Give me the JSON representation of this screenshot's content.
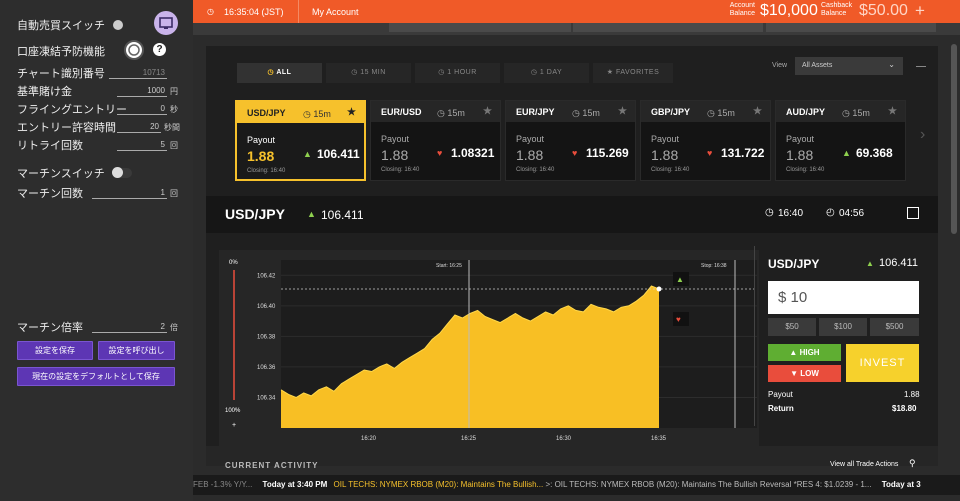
{
  "left": {
    "auto_trade_label": "自動売買スイッチ",
    "freeze_label": "口座凍結予防機能",
    "help_icon": "?",
    "chart_id_label": "チャート識別番号",
    "chart_id_value": "10713",
    "base_bet_label": "基準賭け金",
    "base_bet_value": "1000",
    "base_bet_unit": "円",
    "flying_label": "フライングエントリー",
    "flying_value": "0",
    "flying_unit": "秒",
    "entry_time_label": "エントリー許容時間",
    "entry_time_value": "20",
    "entry_time_unit": "秒間",
    "retry_label": "リトライ回数",
    "retry_value": "5",
    "retry_unit": "回",
    "martin_switch_label": "マーチンスイッチ",
    "martin_count_label": "マーチン回数",
    "martin_count_value": "1",
    "martin_count_unit": "回",
    "martin_mult_label": "マーチン倍率",
    "martin_mult_value": "2",
    "martin_mult_unit": "倍",
    "save_button": "設定を保存",
    "load_button": "設定を呼び出し",
    "default_button": "現在の設定をデフォルトとして保存"
  },
  "topbar": {
    "time": "16:35:04 (JST)",
    "my_account": "My Account",
    "account_balance_label1": "Account",
    "account_balance_label2": "Balance",
    "account_balance": "$10,000",
    "cashback_label1": "Cashback",
    "cashback_label2": "Balance",
    "cashback_balance": "$50.00",
    "plus": "+"
  },
  "tabs": [
    {
      "label": "ALL",
      "icon": "clock-icon"
    },
    {
      "label": "15 MIN",
      "icon": "clock-icon"
    },
    {
      "label": "1 HOUR",
      "icon": "clock-icon"
    },
    {
      "label": "1 DAY",
      "icon": "clock-icon"
    },
    {
      "label": "FAVORITES",
      "icon": "star-icon"
    }
  ],
  "view_label": "View",
  "view_select": "All Assets",
  "cards": [
    {
      "pair": "USD/JPY",
      "time": "15m",
      "payout_label": "Payout",
      "payout": "1.88",
      "price": "106.411",
      "dir": "up",
      "closing": "Closing: 16:40"
    },
    {
      "pair": "EUR/USD",
      "time": "15m",
      "payout_label": "Payout",
      "payout": "1.88",
      "price": "1.08321",
      "dir": "down",
      "closing": "Closing: 16:40"
    },
    {
      "pair": "EUR/JPY",
      "time": "15m",
      "payout_label": "Payout",
      "payout": "1.88",
      "price": "115.269",
      "dir": "down",
      "closing": "Closing: 16:40"
    },
    {
      "pair": "GBP/JPY",
      "time": "15m",
      "payout_label": "Payout",
      "payout": "1.88",
      "price": "131.722",
      "dir": "down",
      "closing": "Closing: 16:40"
    },
    {
      "pair": "AUD/JPY",
      "time": "15m",
      "payout_label": "Payout",
      "payout": "1.88",
      "price": "69.368",
      "dir": "up",
      "closing": "Closing: 16:40"
    }
  ],
  "asset": {
    "pair": "USD/JPY",
    "price": "106.411",
    "close_time": "16:40",
    "remaining": "04:56"
  },
  "chart_data": {
    "type": "area",
    "x_ticks": [
      "16:20",
      "16:25",
      "16:30",
      "16:35"
    ],
    "y_ticks": [
      "106.42",
      "106.40",
      "106.38",
      "106.36",
      "106.34"
    ],
    "ylim": [
      106.32,
      106.43
    ],
    "start_label": "Start: 16:25",
    "stop_label": "Stop: 16:38",
    "left_scale_top": "0%",
    "left_scale_bottom": "100%",
    "left_scale_plus": "+",
    "values": [
      106.345,
      106.342,
      106.34,
      106.343,
      106.341,
      106.345,
      106.347,
      106.344,
      106.349,
      106.352,
      106.355,
      106.358,
      106.357,
      106.36,
      106.362,
      106.359,
      106.363,
      106.366,
      106.369,
      106.372,
      106.378,
      106.382,
      106.388,
      106.394,
      106.392,
      106.395,
      106.397,
      106.393,
      106.391,
      106.389,
      106.392,
      106.395,
      106.392,
      106.39,
      106.393,
      106.396,
      106.394,
      106.398,
      106.4,
      106.397,
      106.396,
      106.401,
      106.399,
      106.398,
      106.396,
      106.399,
      106.4,
      106.403,
      106.407,
      106.413,
      106.411
    ],
    "current_line": 106.411
  },
  "trade": {
    "pair": "USD/JPY",
    "price": "106.411",
    "amount": "$ 10",
    "quick": [
      "$50",
      "$100",
      "$500"
    ],
    "high": "HIGH",
    "low": "LOW",
    "invest": "INVEST",
    "payout_label": "Payout",
    "payout_value": "1.88",
    "return_label": "Return",
    "return_value": "$18.80"
  },
  "activity": {
    "title": "CURRENT ACTIVITY",
    "view_all": "View all Trade Actions"
  },
  "ticker": {
    "pre": "FEB -1.3% Y/Y...",
    "time1": "Today at 3:40 PM",
    "headline1": "OIL TECHS: NYMEX RBOB (M20): Maintains The Bullish...",
    "rest": ">: OIL TECHS: NYMEX RBOB (M20): Maintains The Bullish Reversal *RES 4: $1.0239 - 1...",
    "time2": "Today at 3"
  },
  "colors": {
    "accent": "#f6c12c",
    "orange": "#f05a28",
    "purple": "#5d36b4",
    "up": "#8fd14f",
    "down": "#e94d3c"
  }
}
